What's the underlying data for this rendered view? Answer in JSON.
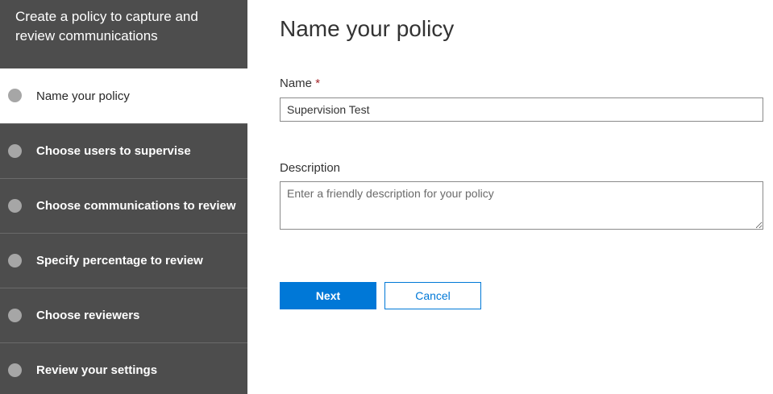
{
  "wizard": {
    "header": "Create a policy to capture and review communications",
    "steps": [
      {
        "label": "Name your policy",
        "active": true
      },
      {
        "label": "Choose users to supervise",
        "active": false
      },
      {
        "label": "Choose communications to review",
        "active": false
      },
      {
        "label": "Specify percentage to review",
        "active": false
      },
      {
        "label": "Choose reviewers",
        "active": false
      },
      {
        "label": "Review your settings",
        "active": false
      }
    ]
  },
  "main": {
    "title": "Name your policy",
    "name_field": {
      "label": "Name",
      "required_marker": "*",
      "value": "Supervision Test"
    },
    "description_field": {
      "label": "Description",
      "value": "",
      "placeholder": "Enter a friendly description for your policy"
    },
    "buttons": {
      "next_label": "Next",
      "cancel_label": "Cancel"
    }
  },
  "colors": {
    "sidebar_bg": "#4d4d4d",
    "accent": "#0078d7",
    "required": "#a4262c"
  }
}
